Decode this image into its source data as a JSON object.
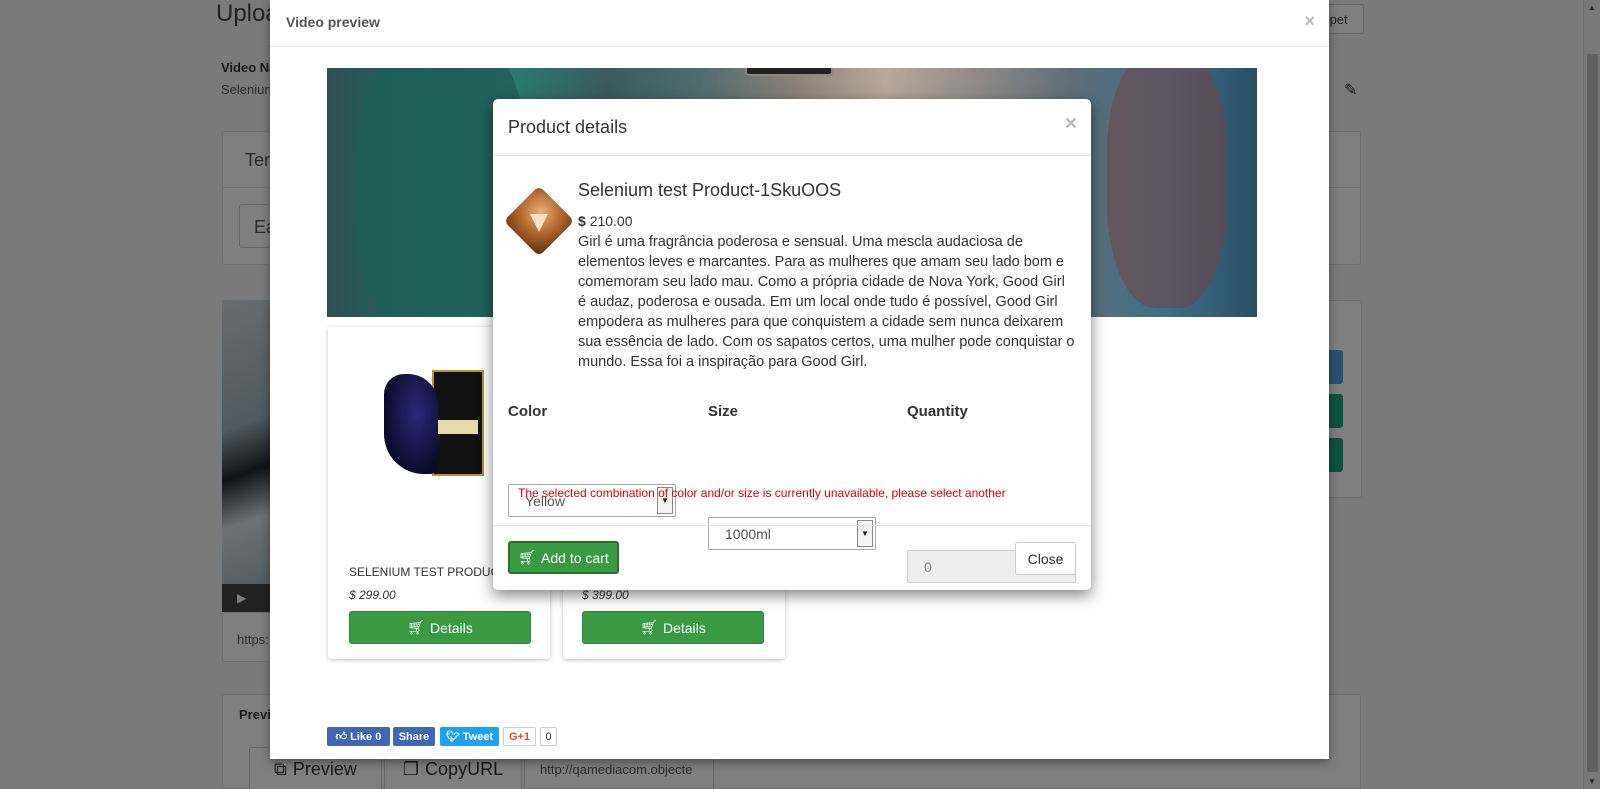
{
  "background_page": {
    "title": "Uploa",
    "video_name_label": "Video Na",
    "video_name_value": "Seleniun",
    "snippet_button": "ppet",
    "panel_heading": "Ter",
    "panel_input": "Ea",
    "url_partial": "https:",
    "preview_section": "Previ",
    "preview_button": "Preview",
    "copyurl_button": "CopyURL",
    "url_value": "http://qamediacom.objecte"
  },
  "video_modal": {
    "title": "Video preview",
    "close_symbol": "×",
    "products": [
      {
        "name": "SELENIUM TEST PRODUCT",
        "price": "$ 299.00",
        "button": "Details"
      },
      {
        "name": "",
        "price": "$ 399.00",
        "button": "Details"
      }
    ],
    "social": {
      "like_label": "Like 0",
      "share_label": "Share",
      "tweet_label": "Tweet",
      "gplus_label": "G+1",
      "gplus_count": "0"
    }
  },
  "product_modal": {
    "title": "Product details",
    "close_symbol": "×",
    "product_name": "Selenium test Product-1SkuOOS",
    "currency": "$",
    "price": "210.00",
    "description": "Girl é uma fragrância poderosa e sensual. Uma mescla audaciosa de elementos leves e marcantes. Para as mulheres que amam seu lado bom e comemoram seu lado mau. Como a própria cidade de Nova York, Good Girl é audaz, poderosa e ousada. Em um local onde tudo é possível, Good Girl empodera as mulheres para que conquistem a cidade sem nunca deixarem sua essência de lado. Com os sapatos certos, uma mulher pode conquistar o mundo. Essa foi a inspiração para Good Girl.",
    "color_label": "Color",
    "color_value": "Yellow",
    "size_label": "Size",
    "size_value": "1000ml",
    "quantity_label": "Quantity",
    "quantity_value": "0",
    "error_message": "The selected combination of color and/or size is currently unavailable, please select another",
    "add_to_cart_label": "Add to cart",
    "close_label": "Close"
  },
  "colors": {
    "accent_green": "#3a9a43",
    "error_red": "#e40000",
    "facebook_blue": "#4267b2",
    "twitter_blue": "#1da1f2"
  }
}
